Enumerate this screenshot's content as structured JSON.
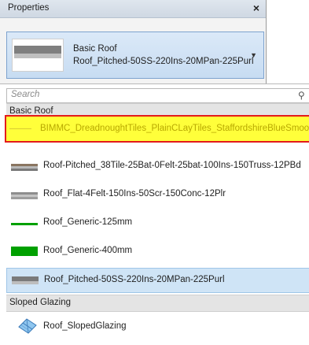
{
  "properties": {
    "title": "Properties",
    "close_glyph": "×",
    "type_selector": {
      "family": "Basic Roof",
      "type": "Roof_Pitched-50SS-220Ins-20MPan-225Purl",
      "arrow": "▼"
    }
  },
  "dropdown": {
    "search_placeholder": "Search",
    "search_icon": "⚲",
    "groups": [
      {
        "header": "Basic Roof"
      },
      {
        "header": "Sloped Glazing"
      }
    ],
    "items": [
      {
        "label": "BIMMC_DreadnoughtTiles_PlainCLayTiles_StaffordshireBlueSmooth",
        "swatch": "line-yellow",
        "highlighted": true
      },
      {
        "label": "Roof-Pitched_38Tile-25Bat-0Felt-25bat-100Ins-150Truss-12PBd",
        "swatch": "brown-grey"
      },
      {
        "label": "Roof_Flat-4Felt-150Ins-50Scr-150Conc-12Plr",
        "swatch": "grey-layered"
      },
      {
        "label": "Roof_Generic-125mm",
        "swatch": "green-thin"
      },
      {
        "label": "Roof_Generic-400mm",
        "swatch": "green-thick"
      },
      {
        "label": "Roof_Pitched-50SS-220Ins-20MPan-225Purl",
        "swatch": "grey-bar",
        "selected": true
      },
      {
        "label": "Roof_SlopedGlazing",
        "swatch": "sloped-glazing-icon"
      }
    ],
    "colors": {
      "highlight_fill": "#ffff3a",
      "highlight_border": "#e31b1b",
      "selected_fill": "#cfe4f6",
      "green": "#00a000"
    }
  }
}
